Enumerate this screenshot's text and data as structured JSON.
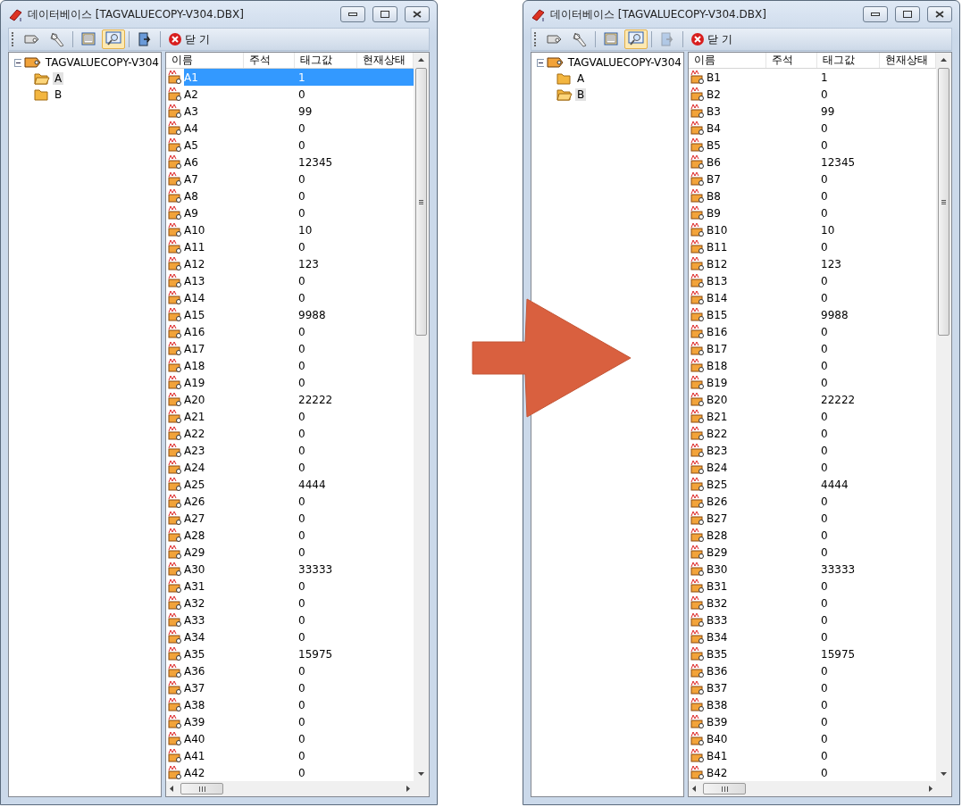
{
  "windows": [
    {
      "title": "데이터베이스 [TAGVALUECOPY-V304.DBX]",
      "toolbar": [
        {
          "kind": "tag",
          "pressed": false,
          "disabled": false
        },
        {
          "kind": "tagfind",
          "pressed": false,
          "disabled": false
        },
        {
          "kind": "sep"
        },
        {
          "kind": "list",
          "pressed": false,
          "disabled": false
        },
        {
          "kind": "find",
          "pressed": true,
          "disabled": false
        },
        {
          "kind": "sep"
        },
        {
          "kind": "export",
          "pressed": false,
          "disabled": false
        },
        {
          "kind": "sep"
        },
        {
          "kind": "close",
          "label": "닫 기",
          "pressed": false,
          "disabled": false
        }
      ],
      "tree": {
        "root": "TAGVALUECOPY-V304",
        "children": [
          {
            "label": "A",
            "selected": true
          },
          {
            "label": "B",
            "selected": false
          }
        ]
      },
      "columns": [
        "이름",
        "주석",
        "태그값",
        "현재상태"
      ],
      "rows": [
        {
          "name": "A1",
          "value": "1",
          "selected": true
        },
        {
          "name": "A2",
          "value": "0",
          "selected": false
        },
        {
          "name": "A3",
          "value": "99",
          "selected": false
        },
        {
          "name": "A4",
          "value": "0",
          "selected": false
        },
        {
          "name": "A5",
          "value": "0",
          "selected": false
        },
        {
          "name": "A6",
          "value": "12345",
          "selected": false
        },
        {
          "name": "A7",
          "value": "0",
          "selected": false
        },
        {
          "name": "A8",
          "value": "0",
          "selected": false
        },
        {
          "name": "A9",
          "value": "0",
          "selected": false
        },
        {
          "name": "A10",
          "value": "10",
          "selected": false
        },
        {
          "name": "A11",
          "value": "0",
          "selected": false
        },
        {
          "name": "A12",
          "value": "123",
          "selected": false
        },
        {
          "name": "A13",
          "value": "0",
          "selected": false
        },
        {
          "name": "A14",
          "value": "0",
          "selected": false
        },
        {
          "name": "A15",
          "value": "9988",
          "selected": false
        },
        {
          "name": "A16",
          "value": "0",
          "selected": false
        },
        {
          "name": "A17",
          "value": "0",
          "selected": false
        },
        {
          "name": "A18",
          "value": "0",
          "selected": false
        },
        {
          "name": "A19",
          "value": "0",
          "selected": false
        },
        {
          "name": "A20",
          "value": "22222",
          "selected": false
        },
        {
          "name": "A21",
          "value": "0",
          "selected": false
        },
        {
          "name": "A22",
          "value": "0",
          "selected": false
        },
        {
          "name": "A23",
          "value": "0",
          "selected": false
        },
        {
          "name": "A24",
          "value": "0",
          "selected": false
        },
        {
          "name": "A25",
          "value": "4444",
          "selected": false
        },
        {
          "name": "A26",
          "value": "0",
          "selected": false
        },
        {
          "name": "A27",
          "value": "0",
          "selected": false
        },
        {
          "name": "A28",
          "value": "0",
          "selected": false
        },
        {
          "name": "A29",
          "value": "0",
          "selected": false
        },
        {
          "name": "A30",
          "value": "33333",
          "selected": false
        },
        {
          "name": "A31",
          "value": "0",
          "selected": false
        },
        {
          "name": "A32",
          "value": "0",
          "selected": false
        },
        {
          "name": "A33",
          "value": "0",
          "selected": false
        },
        {
          "name": "A34",
          "value": "0",
          "selected": false
        },
        {
          "name": "A35",
          "value": "15975",
          "selected": false
        },
        {
          "name": "A36",
          "value": "0",
          "selected": false
        },
        {
          "name": "A37",
          "value": "0",
          "selected": false
        },
        {
          "name": "A38",
          "value": "0",
          "selected": false
        },
        {
          "name": "A39",
          "value": "0",
          "selected": false
        },
        {
          "name": "A40",
          "value": "0",
          "selected": false
        },
        {
          "name": "A41",
          "value": "0",
          "selected": false
        },
        {
          "name": "A42",
          "value": "0",
          "selected": false
        }
      ]
    },
    {
      "title": "데이터베이스 [TAGVALUECOPY-V304.DBX]",
      "toolbar": [
        {
          "kind": "tag",
          "pressed": false,
          "disabled": false
        },
        {
          "kind": "tagfind",
          "pressed": false,
          "disabled": false
        },
        {
          "kind": "sep"
        },
        {
          "kind": "list",
          "pressed": false,
          "disabled": false
        },
        {
          "kind": "find",
          "pressed": true,
          "disabled": false
        },
        {
          "kind": "sep"
        },
        {
          "kind": "export",
          "pressed": false,
          "disabled": true
        },
        {
          "kind": "sep"
        },
        {
          "kind": "close",
          "label": "닫 기",
          "pressed": false,
          "disabled": false
        }
      ],
      "tree": {
        "root": "TAGVALUECOPY-V304",
        "children": [
          {
            "label": "A",
            "selected": false
          },
          {
            "label": "B",
            "selected": true
          }
        ]
      },
      "columns": [
        "이름",
        "주석",
        "태그값",
        "현재상태"
      ],
      "rows": [
        {
          "name": "B1",
          "value": "1",
          "selected": false
        },
        {
          "name": "B2",
          "value": "0",
          "selected": false
        },
        {
          "name": "B3",
          "value": "99",
          "selected": false
        },
        {
          "name": "B4",
          "value": "0",
          "selected": false
        },
        {
          "name": "B5",
          "value": "0",
          "selected": false
        },
        {
          "name": "B6",
          "value": "12345",
          "selected": false
        },
        {
          "name": "B7",
          "value": "0",
          "selected": false
        },
        {
          "name": "B8",
          "value": "0",
          "selected": false
        },
        {
          "name": "B9",
          "value": "0",
          "selected": false
        },
        {
          "name": "B10",
          "value": "10",
          "selected": false
        },
        {
          "name": "B11",
          "value": "0",
          "selected": false
        },
        {
          "name": "B12",
          "value": "123",
          "selected": false
        },
        {
          "name": "B13",
          "value": "0",
          "selected": false
        },
        {
          "name": "B14",
          "value": "0",
          "selected": false
        },
        {
          "name": "B15",
          "value": "9988",
          "selected": false
        },
        {
          "name": "B16",
          "value": "0",
          "selected": false
        },
        {
          "name": "B17",
          "value": "0",
          "selected": false
        },
        {
          "name": "B18",
          "value": "0",
          "selected": false
        },
        {
          "name": "B19",
          "value": "0",
          "selected": false
        },
        {
          "name": "B20",
          "value": "22222",
          "selected": false
        },
        {
          "name": "B21",
          "value": "0",
          "selected": false
        },
        {
          "name": "B22",
          "value": "0",
          "selected": false
        },
        {
          "name": "B23",
          "value": "0",
          "selected": false
        },
        {
          "name": "B24",
          "value": "0",
          "selected": false
        },
        {
          "name": "B25",
          "value": "4444",
          "selected": false
        },
        {
          "name": "B26",
          "value": "0",
          "selected": false
        },
        {
          "name": "B27",
          "value": "0",
          "selected": false
        },
        {
          "name": "B28",
          "value": "0",
          "selected": false
        },
        {
          "name": "B29",
          "value": "0",
          "selected": false
        },
        {
          "name": "B30",
          "value": "33333",
          "selected": false
        },
        {
          "name": "B31",
          "value": "0",
          "selected": false
        },
        {
          "name": "B32",
          "value": "0",
          "selected": false
        },
        {
          "name": "B33",
          "value": "0",
          "selected": false
        },
        {
          "name": "B34",
          "value": "0",
          "selected": false
        },
        {
          "name": "B35",
          "value": "15975",
          "selected": false
        },
        {
          "name": "B36",
          "value": "0",
          "selected": false
        },
        {
          "name": "B37",
          "value": "0",
          "selected": false
        },
        {
          "name": "B38",
          "value": "0",
          "selected": false
        },
        {
          "name": "B39",
          "value": "0",
          "selected": false
        },
        {
          "name": "B40",
          "value": "0",
          "selected": false
        },
        {
          "name": "B41",
          "value": "0",
          "selected": false
        },
        {
          "name": "B42",
          "value": "0",
          "selected": false
        }
      ]
    }
  ]
}
